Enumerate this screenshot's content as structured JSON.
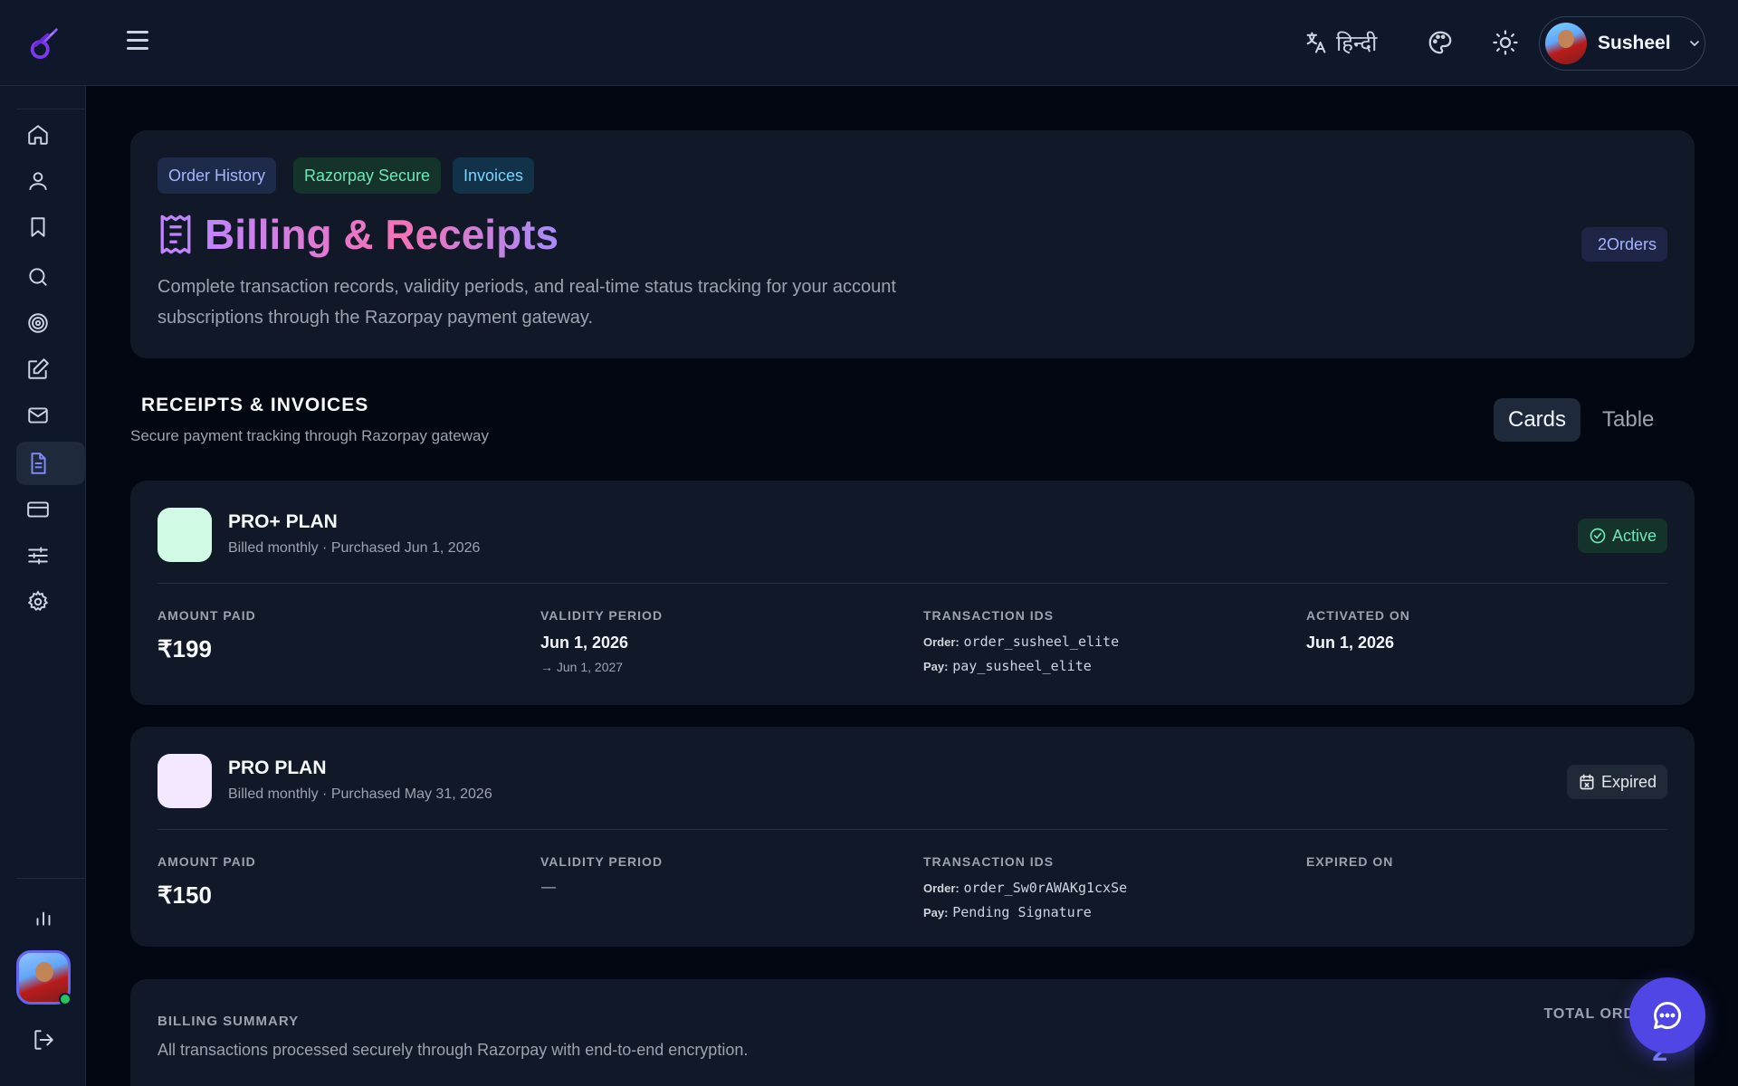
{
  "topbar": {
    "language_label": "हिन्दी",
    "user_name": "Susheel"
  },
  "icons": {
    "logo": "flame-comet-icon",
    "menu": "hamburger-icon",
    "translate": "translate-icon",
    "palette": "palette-icon",
    "theme": "sun-icon",
    "chevron": "chevron-down-icon"
  },
  "sidebar": {
    "items": [
      {
        "icon": "home-icon"
      },
      {
        "icon": "user-icon"
      },
      {
        "icon": "bookmark-icon"
      },
      {
        "icon": "search-icon"
      },
      {
        "icon": "target-icon"
      },
      {
        "icon": "edit-icon"
      },
      {
        "icon": "mail-icon"
      },
      {
        "icon": "document-icon",
        "active": true
      },
      {
        "icon": "credit-card-icon"
      },
      {
        "icon": "sliders-icon"
      },
      {
        "icon": "gear-icon"
      }
    ],
    "bottom": [
      {
        "icon": "bar-chart-icon"
      },
      {
        "icon": "logout-icon"
      }
    ]
  },
  "hero": {
    "chips": [
      "Order History",
      "Razorpay Secure",
      "Invoices"
    ],
    "title": "Billing & Receipts",
    "description": "Complete transaction records, validity periods, and real-time status tracking for your account subscriptions through the Razorpay payment gateway.",
    "orders_badge": "2Orders"
  },
  "receipts": {
    "title": "RECEIPTS & INVOICES",
    "subtitle": "Secure payment tracking through Razorpay gateway",
    "view_toggle": [
      "Cards",
      "Table"
    ],
    "selected_view": "Cards"
  },
  "cards": [
    {
      "plan": "PRO+ PLAN",
      "meta": "Billed monthly · Purchased Jun 1, 2026",
      "status": "Active",
      "amount_label": "AMOUNT PAID",
      "amount": "₹199",
      "validity_label": "VALIDITY PERIOD",
      "validity_start": "Jun 1, 2026",
      "validity_end": "→ Jun 1, 2027",
      "txn_label": "TRANSACTION IDS",
      "order_label": "Order:",
      "order_id": "order_susheel_elite",
      "pay_label": "Pay:",
      "pay_id": "pay_susheel_elite",
      "date_label": "ACTIVATED ON",
      "date_value": "Jun 1, 2026",
      "icon_color": "#d1fae5"
    },
    {
      "plan": "PRO PLAN",
      "meta": "Billed monthly · Purchased May 31, 2026",
      "status": "Expired",
      "amount_label": "AMOUNT PAID",
      "amount": "₹150",
      "validity_label": "VALIDITY PERIOD",
      "validity_start": "—",
      "txn_label": "TRANSACTION IDS",
      "order_label": "Order:",
      "order_id": "order_Sw0rAWAKg1cxSe",
      "pay_label": "Pay:",
      "pay_id": "Pending Signature",
      "date_label": "EXPIRED ON",
      "date_value": "",
      "icon_color": "#f3e8ff"
    }
  ],
  "summary": {
    "label": "BILLING SUMMARY",
    "description": "All transactions processed securely through Razorpay with end-to-end encryption.",
    "total_label": "TOTAL ORD",
    "total_value": "2"
  },
  "chat": {
    "icon": "chat-bubble-icon"
  },
  "colors": {
    "accent": "#6366f1",
    "active_green": "#6ee7b7",
    "background": "#030712",
    "surface": "#111827"
  }
}
